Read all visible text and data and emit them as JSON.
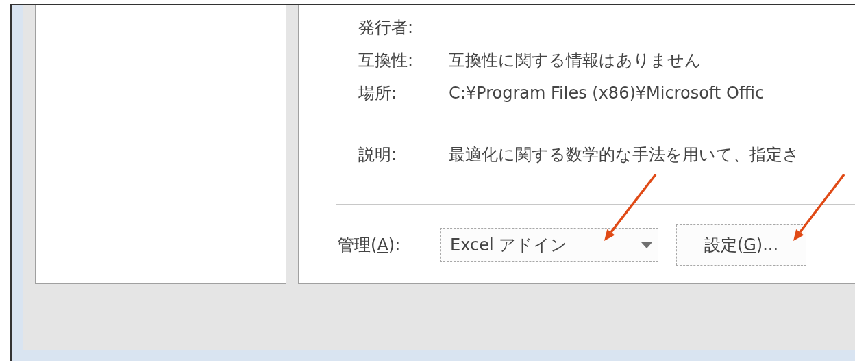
{
  "details": [
    {
      "label": "発行者:"
    },
    {
      "label": "互換性:",
      "value": "互換性に関する情報はありません"
    },
    {
      "label": "場所:",
      "value": "C:¥Program Files (x86)¥Microsoft Offic"
    },
    {
      "label": "説明:",
      "value": "最適化に関する数学的な手法を用いて、指定さ"
    }
  ],
  "manage": {
    "label_before": "管理(",
    "access_key": "A",
    "label_after": "):",
    "dropdown_value": "Excel アドイン",
    "button": {
      "text_before": "設定(",
      "access_key": "G",
      "text_after": ")..."
    }
  },
  "annotations": [
    {
      "kind": "arrow"
    },
    {
      "kind": "arrow"
    }
  ]
}
